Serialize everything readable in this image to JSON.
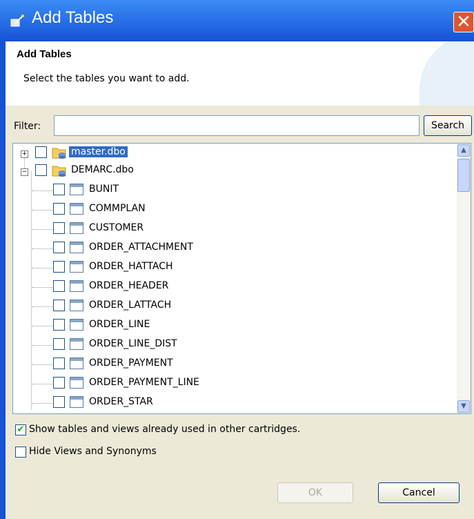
{
  "window": {
    "title": "Add Tables",
    "close_glyph": "✕"
  },
  "banner": {
    "title": "Add Tables",
    "description": "Select the tables you want to add."
  },
  "filter": {
    "label": "Filter:",
    "value": "",
    "placeholder": ""
  },
  "search_label": "Search",
  "tree": {
    "nodes": [
      {
        "label": "master.dbo",
        "type": "schema",
        "expanded": false,
        "selected": true
      },
      {
        "label": "DEMARC.dbo",
        "type": "schema",
        "expanded": true,
        "selected": false
      }
    ],
    "tables": [
      "BUNIT",
      "COMMPLAN",
      "CUSTOMER",
      "ORDER_ATTACHMENT",
      "ORDER_HATTACH",
      "ORDER_HEADER",
      "ORDER_LATTACH",
      "ORDER_LINE",
      "ORDER_LINE_DIST",
      "ORDER_PAYMENT",
      "ORDER_PAYMENT_LINE",
      "ORDER_STAR"
    ]
  },
  "options": {
    "show_used": {
      "label": "Show tables and views already used in other cartridges.",
      "checked": true
    },
    "hide_views": {
      "label": "Hide Views and Synonyms",
      "checked": false
    }
  },
  "buttons": {
    "ok": "OK",
    "cancel": "Cancel",
    "ok_enabled": false
  },
  "colors": {
    "titlebar": "#1652d6",
    "selection": "#316ac5",
    "dialog_bg": "#ece9d8"
  },
  "icons": {
    "title": "wizard-icon",
    "schema": "database-folder-icon",
    "table": "table-icon"
  }
}
